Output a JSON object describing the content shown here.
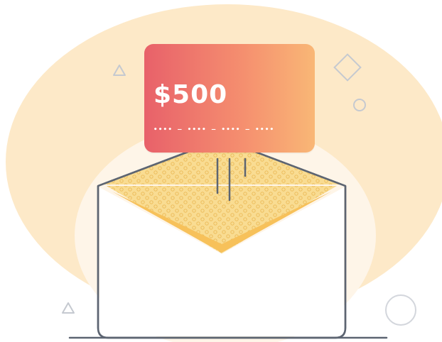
{
  "illustration": {
    "card": {
      "amount": "$500",
      "number_mask": "•••• – •••• – •••• – ••••"
    },
    "colors": {
      "background_blob": "#fde9c8",
      "inner_glow": "#fef5e8",
      "card_gradient_start": "#e8616a",
      "card_gradient_end": "#f9b776",
      "envelope_outline": "#5d6572",
      "envelope_inner": "#f9d98a",
      "envelope_flap": "#f7c15a",
      "decorations": "#c5c9d0"
    }
  }
}
